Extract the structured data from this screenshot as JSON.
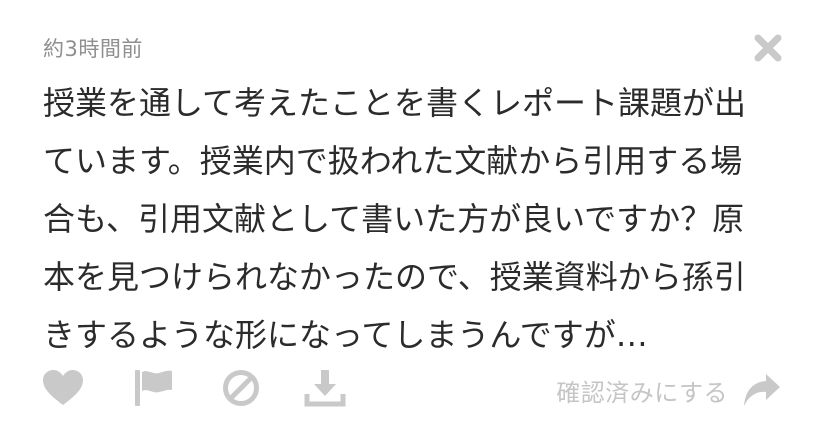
{
  "post": {
    "timestamp": "約3時間前",
    "body": "授業を通して考えたことを書くレポート課題が出ています。授業内で扱われた文献から引用する場合も、引用文献として書いた方が良いですか？原本を見つけられなかったので、授業資料から孫引きするような形になってしまうんですが…"
  },
  "actions": {
    "heart_icon": "heart-icon",
    "flag_icon": "flag-icon",
    "ban_icon": "ban-icon",
    "download_icon": "download-icon",
    "confirm_label": "確認済みにする",
    "confirm_icon": "share-arrow-icon"
  },
  "colors": {
    "icon_gray": "#c9c9c9",
    "text_gray": "#8f8f8f",
    "body_text": "#2b2b2b"
  }
}
